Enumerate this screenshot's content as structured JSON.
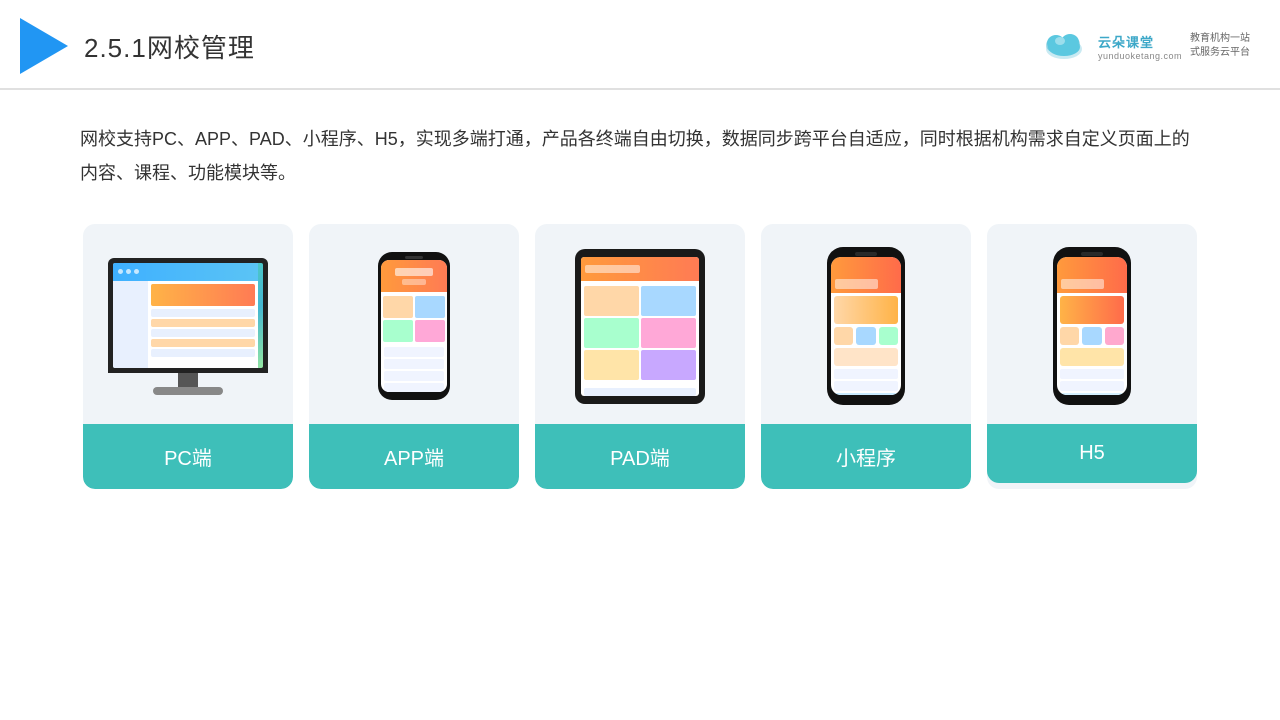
{
  "header": {
    "title": "2.5.1网校管理",
    "brand": {
      "name": "云朵课堂",
      "domain": "yunduoketang.com",
      "tagline": "教育机构一站\n式服务云平台"
    }
  },
  "description": "网校支持PC、APP、PAD、小程序、H5，实现多端打通，产品各终端自由切换，数据同步跨平台自适应，同时根据机构需求自定义页面上的内容、课程、功能模块等。",
  "cards": [
    {
      "label": "PC端",
      "type": "pc"
    },
    {
      "label": "APP端",
      "type": "app"
    },
    {
      "label": "PAD端",
      "type": "pad"
    },
    {
      "label": "小程序",
      "type": "miniprogram"
    },
    {
      "label": "H5",
      "type": "h5"
    }
  ],
  "colors": {
    "accent": "#3ebfb9",
    "header_border": "#e0e0e0",
    "card_bg": "#eef2f7",
    "title_color": "#333333",
    "text_color": "#333333",
    "brand_blue": "#2196F3"
  }
}
